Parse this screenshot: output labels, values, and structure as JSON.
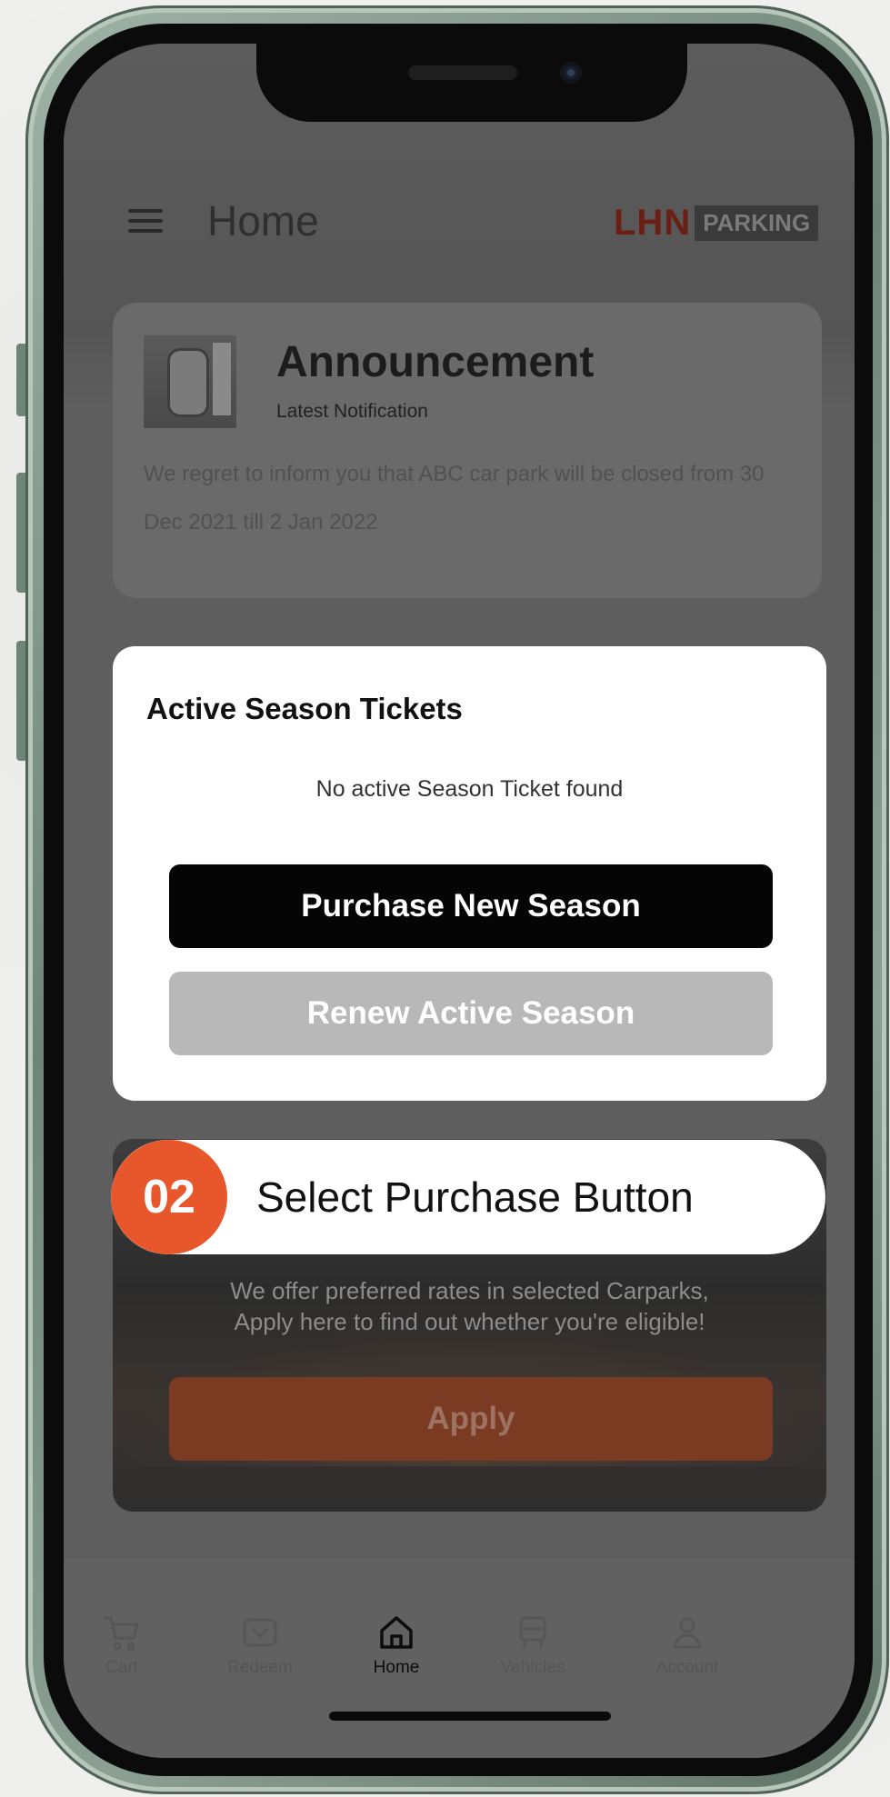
{
  "header": {
    "title": "Home",
    "logo_main": "LHN",
    "logo_sub": "PARKING"
  },
  "announcement": {
    "title": "Announcement",
    "subtitle": "Latest Notification",
    "body": "We regret to inform you that ABC car park will be closed from 30 Dec 2021 till 2 Jan 2022"
  },
  "season_modal": {
    "title": "Active Season Tickets",
    "empty_message": "No active Season Ticket found",
    "purchase_label": "Purchase New Season",
    "renew_label": "Renew Active Season"
  },
  "callout": {
    "step": "02",
    "text": "Select Purchase Button"
  },
  "rates_card": {
    "body_line1": "We offer preferred rates in selected Carparks,",
    "body_line2": "Apply here to find out whether you're eligible!",
    "apply_label": "Apply"
  },
  "nav": {
    "items": [
      {
        "label": "Cart",
        "icon": "cart-icon"
      },
      {
        "label": "Redeem",
        "icon": "redeem-icon"
      },
      {
        "label": "Home",
        "icon": "home-icon",
        "active": true
      },
      {
        "label": "Vehicles",
        "icon": "vehicle-icon"
      },
      {
        "label": "Account",
        "icon": "account-icon"
      }
    ]
  },
  "colors": {
    "accent": "#e8572c",
    "primary_button": "#050505",
    "disabled_button": "#b8b8b8"
  }
}
